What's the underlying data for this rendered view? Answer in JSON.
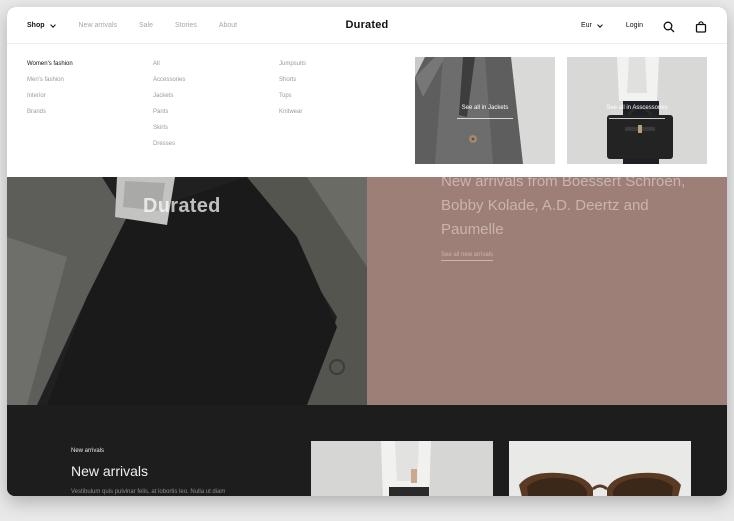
{
  "header": {
    "nav": [
      {
        "label": "Shop",
        "active": true
      },
      {
        "label": "New arrivals",
        "active": false
      },
      {
        "label": "Sale",
        "active": false
      },
      {
        "label": "Stories",
        "active": false
      },
      {
        "label": "About",
        "active": false
      }
    ],
    "logo": "Durated",
    "currency": "Eur",
    "login": "Login",
    "search_icon": "search-icon",
    "bag_icon": "bag-icon"
  },
  "mega_menu": {
    "categories": [
      "Women's fashion",
      "Men's fashion",
      "Interior",
      "Brands"
    ],
    "col2": [
      "All",
      "Accessories",
      "Jackets",
      "Pants",
      "Skirts",
      "Dresses"
    ],
    "col3": [
      "Jumpsuits",
      "Shorts",
      "Tops",
      "Knitwear"
    ],
    "tiles": [
      {
        "caption": "See all in Jackets"
      },
      {
        "caption": "See all in Asscessories"
      }
    ]
  },
  "hero": {
    "logo": "Durated",
    "heading": "New arrivals from Boessert Schroen, Bobby Kolade, A.D. Deertz and Paumelle",
    "link": "See all new arrivals"
  },
  "band": {
    "eyebrow": "New arrivals",
    "title": "New arrivals",
    "body": "Vestibulum quis pulvinar felis, at lobortis leo. Nulla ut diam"
  },
  "colors": {
    "hero_right_bg": "#9e7f77",
    "band_bg": "#1d1d1d",
    "text_muted": "#a7a7a7"
  }
}
